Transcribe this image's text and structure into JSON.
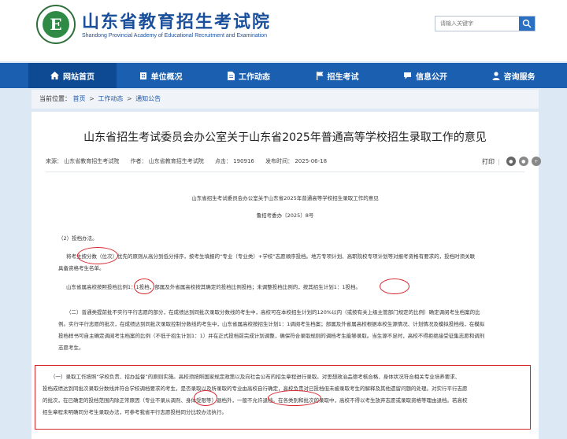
{
  "header": {
    "logo_letter": "E",
    "site_title": "山东省教育招生考试院",
    "site_subtitle": "Shandong Provincial Academy of Educational Recruitment and Examination",
    "search_placeholder": "请输入关键字"
  },
  "nav": [
    {
      "label": "网站首页",
      "icon": "home-icon"
    },
    {
      "label": "单位概况",
      "icon": "building-icon"
    },
    {
      "label": "工作动态",
      "icon": "document-icon"
    },
    {
      "label": "招生考试",
      "icon": "flag-icon"
    },
    {
      "label": "信息公开",
      "icon": "chat-icon"
    },
    {
      "label": "咨询服务",
      "icon": "person-icon"
    }
  ],
  "breadcrumb": {
    "prefix": "当前位置：",
    "items": [
      "首页",
      "工作动态",
      "通知公告"
    ],
    "separator": ">"
  },
  "article": {
    "title": "山东省招生考试委员会办公室关于山东省2025年普通高等学校招生录取工作的意见",
    "meta": {
      "source": "来源：  山东省教育招生考试院",
      "author": "作者：  山东省教育招生考试院",
      "clicks": "点击：  190916",
      "date": "发布时间：  2025-06-18"
    },
    "print_label": "打印",
    "doc_heading": "山东省招生考试委员会办公室关于山东省2025年普通高等学校招生录取工作的意见",
    "doc_number": "鲁招考委办〔2025〕8号",
    "paragraphs": {
      "p1": "（2）投档办法。",
      "p2_line1": "将考生按分数（位次）优先的原则从高分到低分排序，按考生填报的“专业（专业类）+学校”志愿顺序投档。地方专项计划、高职院校专项计划等对报考资格有要求的，投档时须关联",
      "p2_line2": "具备资格考生名单。",
      "p3": "山东省属高校按照投档比例1：1投档，部属及外省属高校按其确定的投档比例投档；未调整投档比例的，按其招生计划1：1投档。",
      "p4_line1": "（二）普通类提前批不实行平行志愿的部分，在成绩达到同批次录取分数线的考生中，高校可在本校招生计划的120%以内（或按有关上级主管部门规定的比例）确定调阅考生档案的比",
      "p4_line2": "例。实行平行志愿的批次，在成绩达到同批次录取控制分数线的考生中，山东省属高校按招生计划1：1调阅考生档案；部属及外省属高校根据本校生源情况、计划情况及模拟投档线，在模拟",
      "p4_line3": "投档样书可自主确定调阅考生档案的比例（不低于招生计划1：1）并在正式投档前完成计划调整，确保符合录取规则的调档考生能够录取。当生源不足时，高校不得拒绝接受征集志愿和调剂",
      "p4_line4": "志愿考生。",
      "p5_line1": "（一）录取工作按照“学校负责、招办监督”的原则实施。高校须按照国家规定政策以及向社会公布的招生章程进行录取。对思想政治品德考核合格、身体状况符合相关专业培养要求、",
      "p5_line2": "投档成绩达到同批次录取分数线并符合学校调档要求的考生，是否录取以及所录取的专业由高校自行确定，高校负责对已投档但未被录取考生的解释及其他遗留问题的处理。对实行平行志愿",
      "p5_line3": "的批次，在已确定的投档范围内除正常原因（专业不录从调剂、身体受限等）退档外，一般不允许退档。在各类别和批次的录取中，高校不得以考生放弃志愿或录取资格等理由退档。若高校",
      "p5_line4": "招生章程未明确同分考生录取办法，可参考我省平行志愿投档同分比较办法执行。"
    }
  },
  "colors": {
    "brand_blue": "#1b5fb1",
    "nav_active": "#0e4a93",
    "annotation_red": "#d8262d",
    "background": "#dce9f5"
  }
}
